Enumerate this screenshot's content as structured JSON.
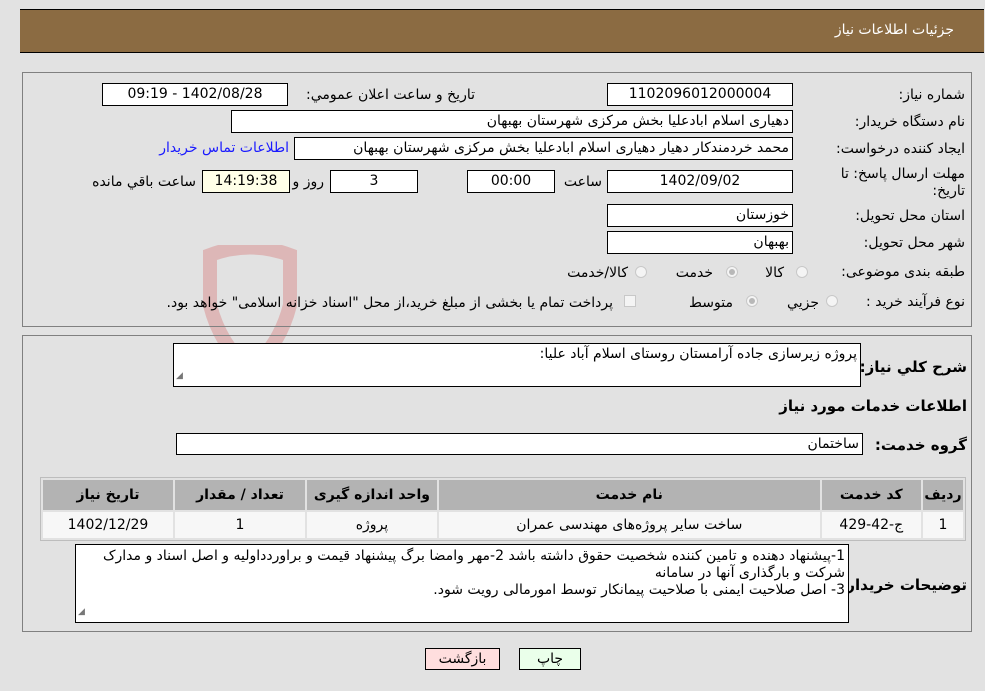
{
  "header": {
    "title": "جزئیات اطلاعات نیاز"
  },
  "details": {
    "need_number_label": "شماره نیاز:",
    "need_number": "1102096012000004",
    "announce_label": "تاریخ و ساعت اعلان عمومي:",
    "announce_value": "1402/08/28 - 09:19",
    "buyer_org_label": "نام دستگاه خریدار:",
    "buyer_org": "دهیاری اسلام ابادعلیا بخش مرکزی شهرستان بهبهان",
    "creator_label": "ایجاد کننده درخواست:",
    "creator": "محمد خردمندکار دهیار دهیاری اسلام ابادعلیا بخش مرکزی شهرستان بهبهان",
    "contact_link": "اطلاعات تماس خریدار",
    "deadline_label": "مهلت ارسال پاسخ: تا تاریخ:",
    "deadline_date": "1402/09/02",
    "time_label": "ساعت",
    "deadline_time": "00:00",
    "days_value": "3",
    "days_label": "روز و",
    "remaining_time": "14:19:38",
    "remaining_label": "ساعت باقي مانده",
    "province_label": "استان محل تحویل:",
    "province": "خوزستان",
    "city_label": "شهر محل تحویل:",
    "city": "بهبهان",
    "category_label": "طبقه بندی موضوعی:",
    "category_options": [
      {
        "label": "کالا",
        "selected": false
      },
      {
        "label": "خدمت",
        "selected": true
      },
      {
        "label": "کالا/خدمت",
        "selected": false
      }
    ],
    "process_label": "نوع فرآیند خرید :",
    "process_options": [
      {
        "label": "جزيي",
        "selected": false
      },
      {
        "label": "متوسط",
        "selected": true
      }
    ],
    "payment_note": "پرداخت تمام یا بخشی از مبلغ خرید،از محل \"اسناد خزانه اسلامی\" خواهد بود."
  },
  "description": {
    "label": "شرح کلي نیاز:",
    "value": "پروژه زیرسازی جاده آرامستان روستای اسلام آباد علیا:"
  },
  "services": {
    "title": "اطلاعات خدمات مورد نیاز",
    "group_label": "گروه خدمت:",
    "group_value": "ساختمان",
    "columns": [
      "ردیف",
      "کد خدمت",
      "نام خدمت",
      "واحد اندازه گیری",
      "تعداد / مقدار",
      "تاریخ نیاز"
    ],
    "rows": [
      [
        "1",
        "ج-42-429",
        "ساخت سایر پروژه‌های مهندسی عمران",
        "پروژه",
        "1",
        "1402/12/29"
      ]
    ]
  },
  "buyer_notes": {
    "label": "توضیحات خریدار:",
    "lines": [
      "1-پیشنهاد دهنده و تامین کننده شخصیت حقوق داشته باشد 2-مهر وامضا برگ پیشنهاد قیمت و براوردداولیه و اصل اسناد و مدارک شرکت و بارگذاری آنها در سامانه",
      "3- اصل صلاحیت ایمنی با صلاحیت پیمانکار توسط امورمالی رویت شود."
    ]
  },
  "buttons": {
    "print": "چاپ",
    "back": "بازگشت"
  },
  "colors": {
    "header_bg": "#8b6b42",
    "print_bg": "#eaffea",
    "back_bg": "#ffdede",
    "link": "#1a1aff"
  }
}
